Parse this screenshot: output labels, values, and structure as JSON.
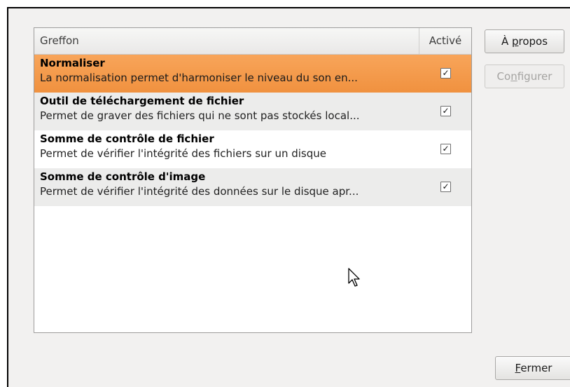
{
  "columns": {
    "plugin": "Greffon",
    "active": "Activé"
  },
  "plugins": [
    {
      "name": "Normaliser",
      "description": "La normalisation permet d'harmoniser le niveau du son en...",
      "active": true,
      "selected": true
    },
    {
      "name": "Outil de téléchargement de fichier",
      "description": "Permet de graver des fichiers qui ne sont pas stockés local...",
      "active": true,
      "selected": false
    },
    {
      "name": "Somme de contrôle de fichier",
      "description": "Permet de vérifier l'intégrité des fichiers sur un disque",
      "active": true,
      "selected": false
    },
    {
      "name": "Somme de contrôle d'image",
      "description": "Permet de vérifier l'intégrité des données sur le disque apr...",
      "active": true,
      "selected": false
    }
  ],
  "buttons": {
    "about_pre": "À ",
    "about_mnemonic": "p",
    "about_post": "ropos",
    "configure_pre": "Co",
    "configure_mnemonic": "n",
    "configure_post": "figurer",
    "close_mnemonic": "F",
    "close_post": "ermer"
  },
  "check_glyph": "✓"
}
